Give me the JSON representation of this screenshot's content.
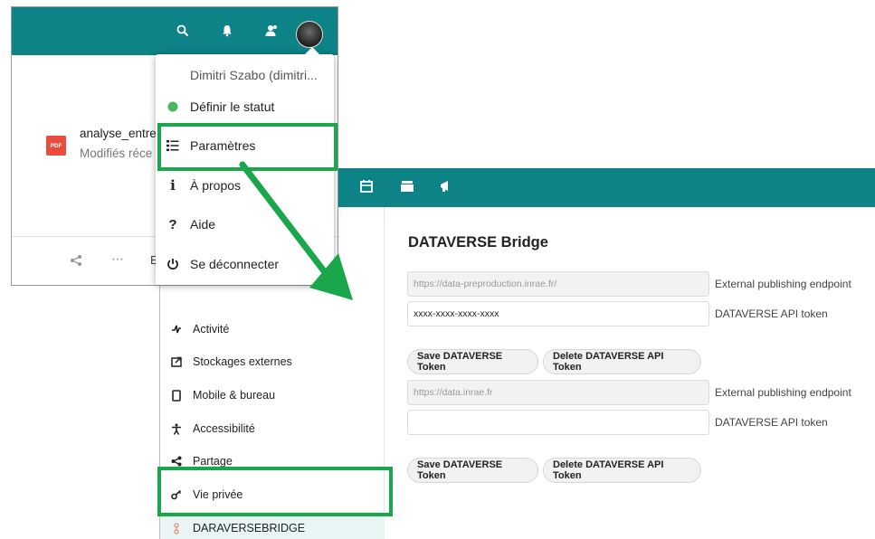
{
  "settings": {
    "sidebar_items": [
      {
        "label": "Activité",
        "icon": "activity-icon"
      },
      {
        "label": "Stockages externes",
        "icon": "external-storage-icon"
      },
      {
        "label": "Mobile & bureau",
        "icon": "mobile-icon"
      },
      {
        "label": "Accessibilité",
        "icon": "accessibility-icon"
      },
      {
        "label": "Partage",
        "icon": "share-icon"
      },
      {
        "label": "Vie privée",
        "icon": "privacy-key-icon"
      },
      {
        "label": "DARAVERSEBRIDGE",
        "icon": "daraverse-bridge-icon"
      }
    ],
    "main": {
      "title": "DATAVERSE Bridge",
      "block1": {
        "endpoint_value": "https://data-preproduction.inrae.fr/",
        "endpoint_label": "External publishing endpoint",
        "token_value": "xxxx-xxxx-xxxx-xxxx",
        "token_label": "DATAVERSE API token",
        "save_label": "Save DATAVERSE Token",
        "delete_label": "Delete DATAVERSE API Token"
      },
      "block2": {
        "endpoint_value": "https://data.inrae.fr",
        "endpoint_label": "External publishing endpoint",
        "token_value": "",
        "token_label": "DATAVERSE API token",
        "save_label": "Save DATAVERSE Token",
        "delete_label": "Delete DATAVERSE API Token"
      }
    },
    "header_icons": [
      "calendar-icon",
      "deck-icon",
      "announcement-icon"
    ]
  },
  "files": {
    "file_name": "analyse_entre",
    "file_meta": "Modifiés réce",
    "pdf_badge": "PDF",
    "footer_letter": "E"
  },
  "user_menu": {
    "user_name": "Dimitri Szabo (dimitri...",
    "items": [
      {
        "label": "Définir le statut",
        "icon": "status-dot-icon"
      },
      {
        "label": "Paramètres",
        "icon": "settings-list-icon"
      },
      {
        "label": "À propos",
        "icon": "info-icon"
      },
      {
        "label": "Aide",
        "icon": "help-icon"
      },
      {
        "label": "Se déconnecter",
        "icon": "logout-icon"
      }
    ],
    "status_color": "#46ba61"
  },
  "colors": {
    "header_teal": "#0d8388",
    "highlight_green": "#1aa64a",
    "pdf_red": "#e74c3c"
  }
}
